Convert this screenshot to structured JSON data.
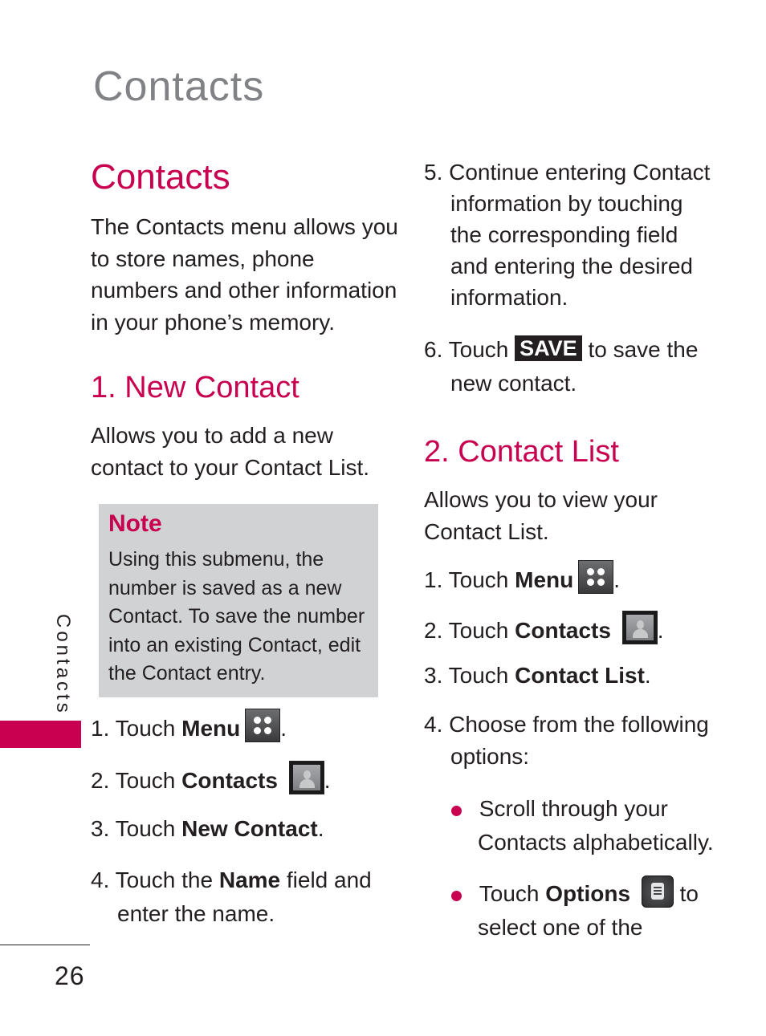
{
  "page": {
    "chapter_title": "Contacts",
    "side_label": "Contacts",
    "page_number": "26",
    "accent_color": "#c8004f"
  },
  "left": {
    "heading": "Contacts",
    "intro_lines": [
      "The Contacts menu allows you",
      "to store names, phone",
      "numbers and other information",
      "in your phone’s memory."
    ],
    "section1": {
      "heading": "1. New Contact",
      "desc_lines": [
        "Allows you to add a new",
        "contact to your Contact List."
      ],
      "note": {
        "title": "Note",
        "lines": [
          "Using this submenu, the",
          "number is saved as a new",
          "Contact. To save the number",
          "into an existing Contact, edit",
          "the Contact entry."
        ]
      },
      "steps": [
        {
          "num": "1.",
          "pre": "Touch ",
          "bold": "Menu",
          "icon": "menu-grid-icon",
          "post": "."
        },
        {
          "num": "2.",
          "pre": "Touch ",
          "bold": "Contacts",
          "icon": "contacts-person-icon",
          "post": "."
        },
        {
          "num": "3.",
          "pre": "Touch ",
          "bold": "New Contact",
          "post": "."
        },
        {
          "num": "4.",
          "pre": "Touch the ",
          "bold": "Name",
          "post": " field and",
          "line2": "enter the name."
        }
      ]
    }
  },
  "right": {
    "step5": {
      "num": "5.",
      "lines": [
        "Continue entering Contact",
        "information by touching",
        "the corresponding field",
        "and entering the desired",
        "information."
      ]
    },
    "step6": {
      "num": "6.",
      "pre": "Touch ",
      "chip": "SAVE",
      "post": " to save the",
      "line2": "new contact."
    },
    "section2": {
      "heading": "2. Contact List",
      "desc_lines": [
        "Allows you to view your",
        "Contact List."
      ],
      "steps": [
        {
          "num": "1.",
          "pre": "Touch ",
          "bold": "Menu",
          "icon": "menu-grid-icon",
          "post": "."
        },
        {
          "num": "2.",
          "pre": "Touch ",
          "bold": "Contacts",
          "icon": "contacts-person-icon",
          "post": "."
        },
        {
          "num": "3.",
          "pre": "Touch ",
          "bold": "Contact List",
          "post": "."
        },
        {
          "num": "4.",
          "line1": "Choose from the following",
          "line2": "options:"
        }
      ],
      "bullets": [
        {
          "line1": "Scroll through your",
          "line2": "Contacts alphabetically."
        },
        {
          "pre": "Touch ",
          "bold": "Options",
          "icon": "options-list-icon",
          "post": " to",
          "line2": "select one of the"
        }
      ]
    }
  }
}
